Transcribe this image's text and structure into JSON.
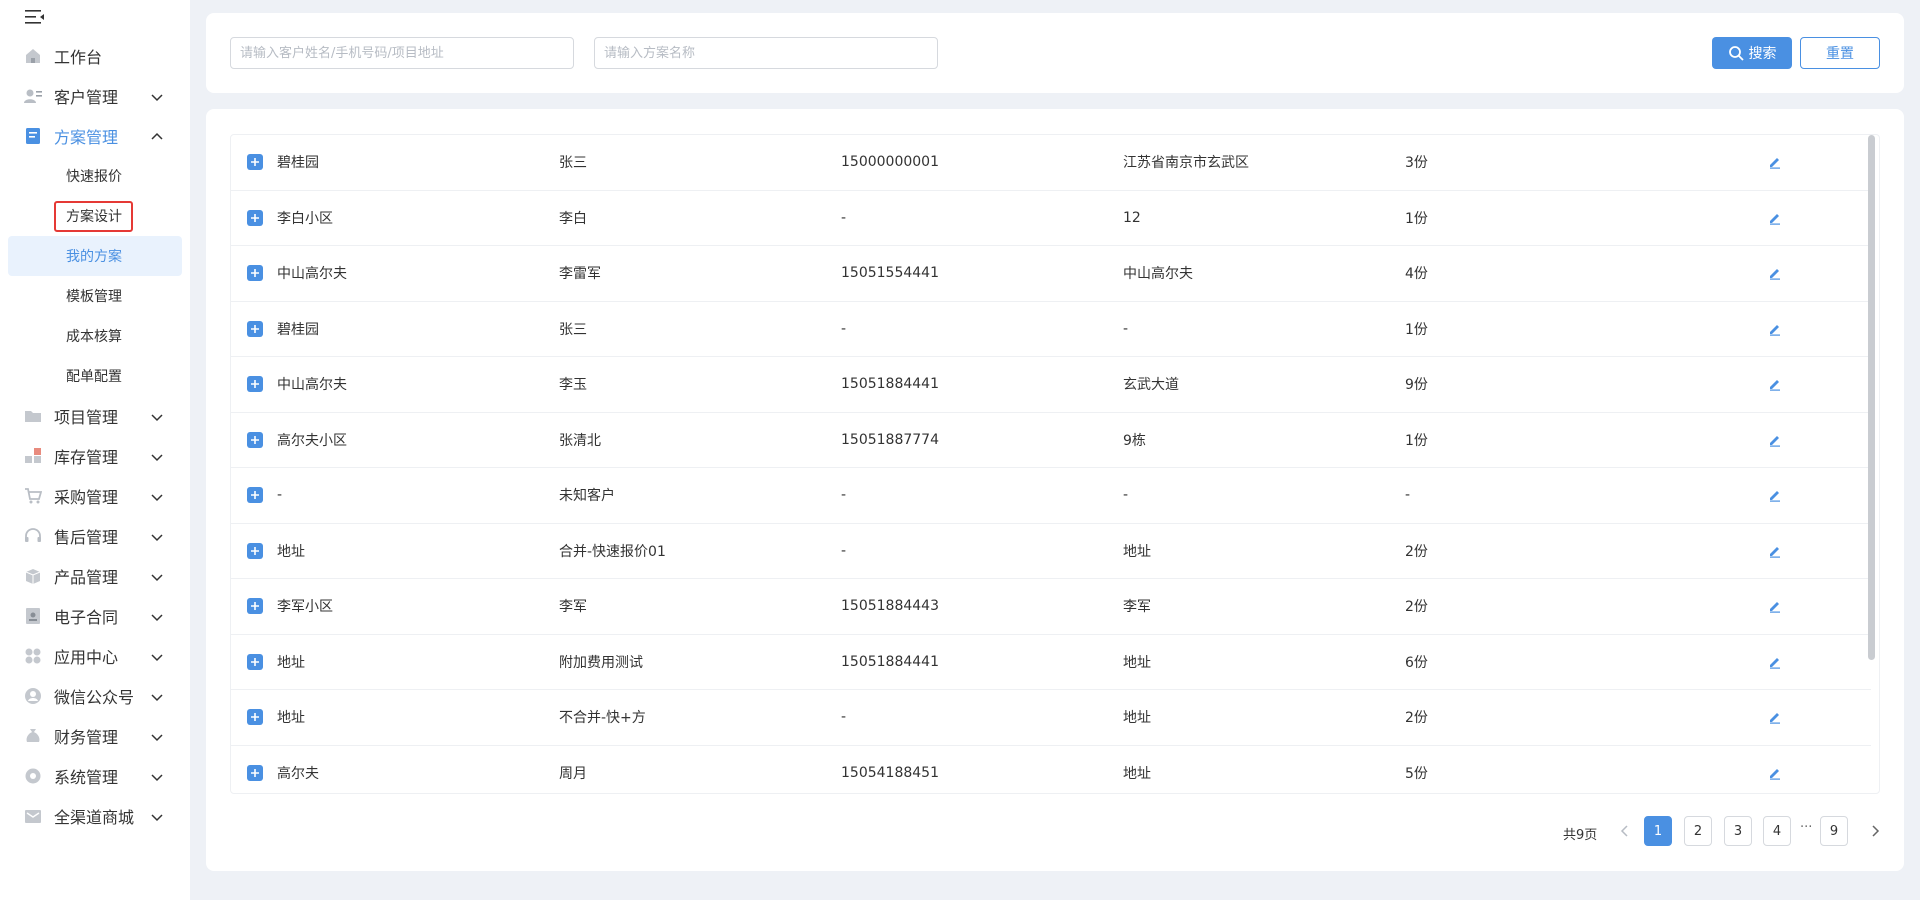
{
  "nav": {
    "workbench": "工作台",
    "customer": "客户管理",
    "plan": "方案管理",
    "plan_sub": [
      "快速报价",
      "方案设计",
      "我的方案",
      "模板管理",
      "成本核算",
      "配单配置"
    ],
    "project": "项目管理",
    "inventory": "库存管理",
    "purchase": "采购管理",
    "aftersale": "售后管理",
    "product": "产品管理",
    "contract": "电子合同",
    "appcenter": "应用中心",
    "wechat": "微信公众号",
    "finance": "财务管理",
    "system": "系统管理",
    "mall": "全渠道商城"
  },
  "search": {
    "customer_placeholder": "请输入客户姓名/手机号码/项目地址",
    "plan_placeholder": "请输入方案名称",
    "search_label": "搜索",
    "reset_label": "重置"
  },
  "table": {
    "rows": [
      {
        "name": "碧桂园",
        "customer": "张三",
        "phone": "15000000001",
        "address": "江苏省南京市玄武区",
        "count": "3份"
      },
      {
        "name": "李白小区",
        "customer": "李白",
        "phone": "-",
        "address": "12",
        "count": "1份"
      },
      {
        "name": "中山高尔夫",
        "customer": "李雷军",
        "phone": "15051554441",
        "address": "中山高尔夫",
        "count": "4份"
      },
      {
        "name": "碧桂园",
        "customer": "张三",
        "phone": "-",
        "address": "-",
        "count": "1份"
      },
      {
        "name": "中山高尔夫",
        "customer": "李玉",
        "phone": "15051884441",
        "address": "玄武大道",
        "count": "9份"
      },
      {
        "name": "高尔夫小区",
        "customer": "张清北",
        "phone": "15051887774",
        "address": "9栋",
        "count": "1份"
      },
      {
        "name": "-",
        "customer": "未知客户",
        "phone": "-",
        "address": "-",
        "count": "-"
      },
      {
        "name": "地址",
        "customer": "合并-快速报价01",
        "phone": "-",
        "address": "地址",
        "count": "2份"
      },
      {
        "name": "李军小区",
        "customer": "李军",
        "phone": "15051884443",
        "address": "李军",
        "count": "2份"
      },
      {
        "name": "地址",
        "customer": "附加费用测试",
        "phone": "15051884441",
        "address": "地址",
        "count": "6份"
      },
      {
        "name": "地址",
        "customer": "不合并-快+方",
        "phone": "-",
        "address": "地址",
        "count": "2份"
      },
      {
        "name": "高尔夫",
        "customer": "周月",
        "phone": "15054188451",
        "address": "地址",
        "count": "5份"
      }
    ]
  },
  "pagination": {
    "total": "共9页",
    "pages": [
      "1",
      "2",
      "3",
      "4",
      "9"
    ],
    "ellipsis": "···"
  },
  "colors": {
    "accent": "#4a90e2",
    "highlight_border": "#e53935"
  }
}
